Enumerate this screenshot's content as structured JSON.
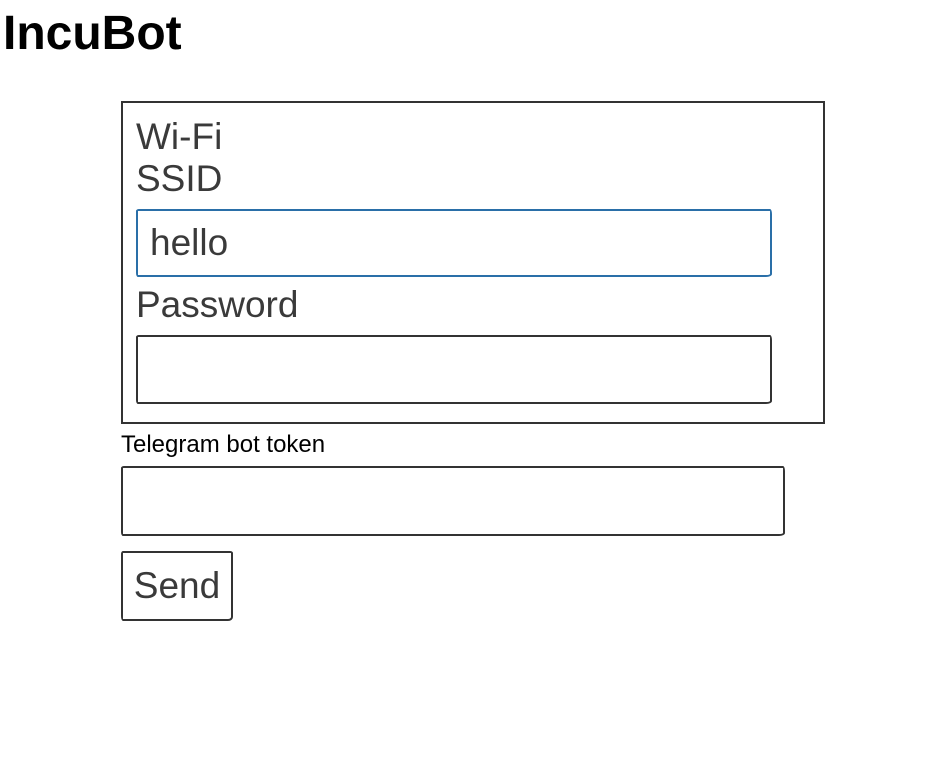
{
  "app": {
    "title": "IncuBot"
  },
  "wifi": {
    "ssid_label": "Wi-Fi SSID",
    "ssid_value": "hello",
    "password_label": "Password",
    "password_value": ""
  },
  "telegram": {
    "token_label": "Telegram bot token",
    "token_value": ""
  },
  "actions": {
    "send_label": "Send"
  },
  "colors": {
    "focus_border": "#2a6fa8",
    "border": "#333333",
    "text": "#3a3a3a"
  }
}
